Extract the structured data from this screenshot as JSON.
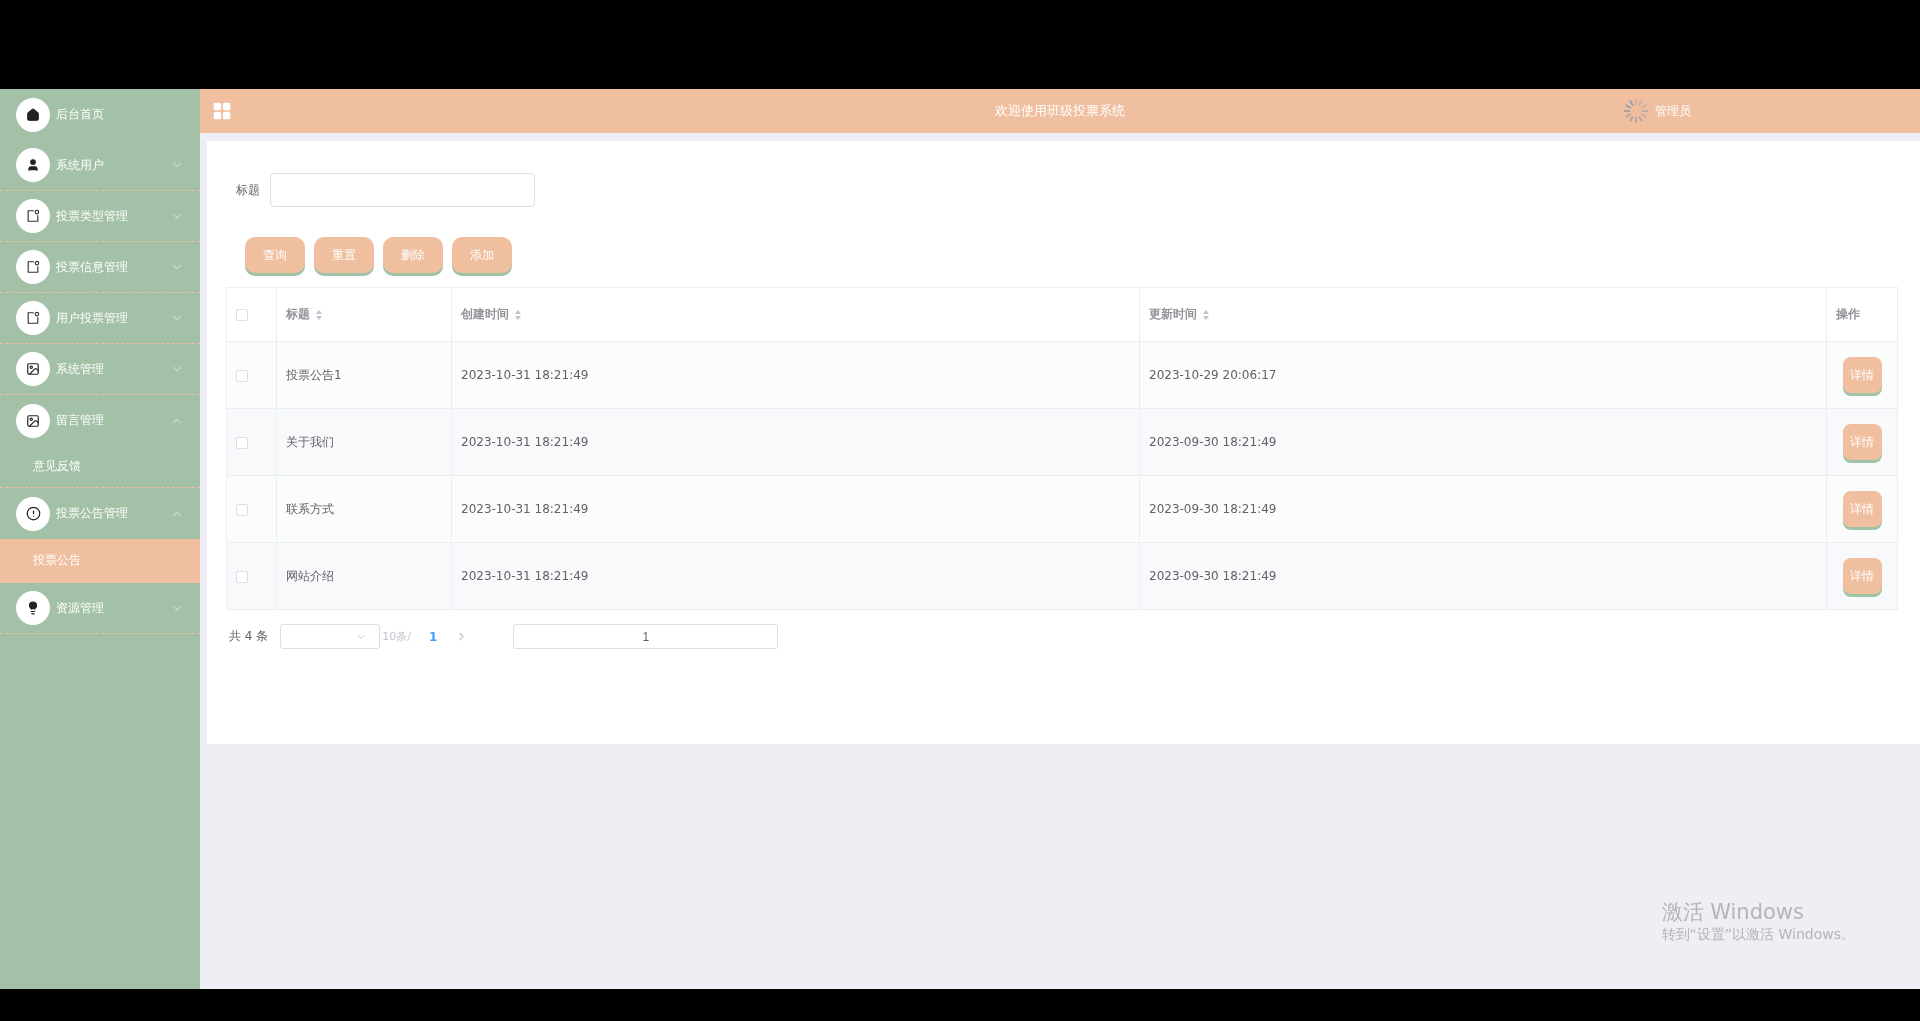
{
  "header": {
    "title": "欢迎使用班级投票系统",
    "user": "管理员"
  },
  "sidebar": {
    "items": [
      {
        "label": "后台首页",
        "kind": "link"
      },
      {
        "label": "系统用户",
        "kind": "menu",
        "expanded": false
      },
      {
        "label": "投票类型管理",
        "kind": "menu",
        "expanded": false
      },
      {
        "label": "投票信息管理",
        "kind": "menu",
        "expanded": false
      },
      {
        "label": "用户投票管理",
        "kind": "menu",
        "expanded": false
      },
      {
        "label": "系统管理",
        "kind": "menu",
        "expanded": false
      },
      {
        "label": "留言管理",
        "kind": "menu",
        "expanded": true,
        "children": [
          {
            "label": "意见反馈",
            "selected": false
          }
        ]
      },
      {
        "label": "投票公告管理",
        "kind": "menu",
        "expanded": true,
        "children": [
          {
            "label": "投票公告",
            "selected": true
          }
        ]
      },
      {
        "label": "资源管理",
        "kind": "menu",
        "expanded": false
      }
    ]
  },
  "search": {
    "label": "标题"
  },
  "buttons": [
    "查询",
    "重置",
    "删除",
    "添加"
  ],
  "table": {
    "all_checked": false,
    "columns": [
      {
        "label": "标题",
        "sortable": true
      },
      {
        "label": "创建时间",
        "sortable": true
      },
      {
        "label": "更新时间",
        "sortable": true
      },
      {
        "label": "操作",
        "sortable": false
      }
    ],
    "rows": [
      {
        "checked": false,
        "title": "投票公告1",
        "created": "2023-10-31 18:21:49",
        "updated": "2023-10-29 20:06:17",
        "action": "详情"
      },
      {
        "checked": false,
        "title": "关于我们",
        "created": "2023-10-31 18:21:49",
        "updated": "2023-09-30 18:21:49",
        "action": "详情"
      },
      {
        "checked": false,
        "title": "联系方式",
        "created": "2023-10-31 18:21:49",
        "updated": "2023-09-30 18:21:49",
        "action": "详情"
      },
      {
        "checked": false,
        "title": "网站介绍",
        "created": "2023-10-31 18:21:49",
        "updated": "2023-09-30 18:21:49",
        "action": "详情"
      }
    ]
  },
  "pagination": {
    "total": "共 4 条",
    "page_size": "10条/",
    "pages": [
      {
        "label": "1",
        "selected": true
      }
    ],
    "goto_value": "1"
  },
  "os_notice": {
    "title": "激活 Windows",
    "subtitle": "转到“设置”以激活 Windows。"
  }
}
